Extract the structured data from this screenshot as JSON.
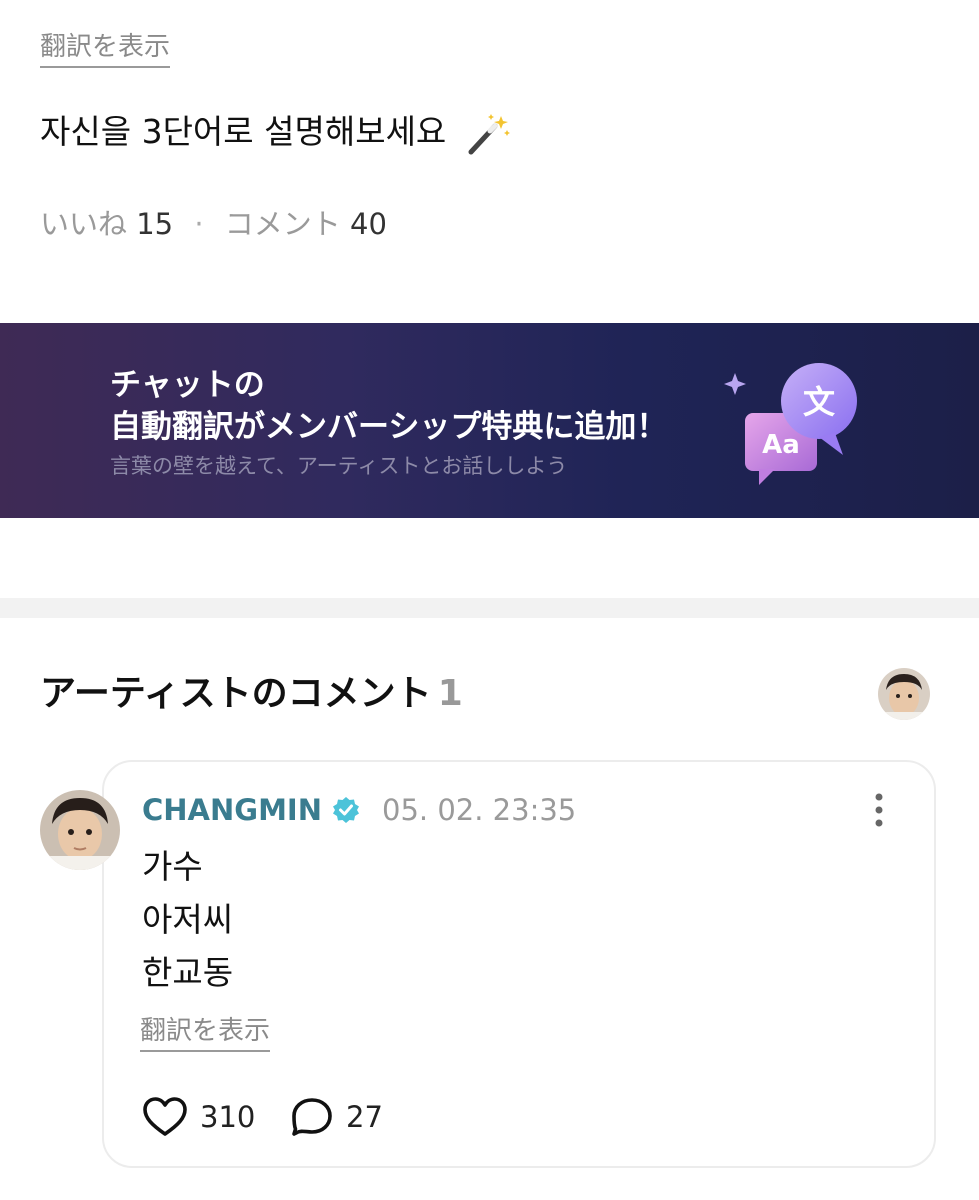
{
  "post": {
    "translate_label": "翻訳を表示",
    "text": "자신을 3단어로 설명해보세요",
    "wand_icon": "magic-wand-icon",
    "likes_label": "いいね",
    "likes_count": "15",
    "separator": "·",
    "comments_label": "コメント",
    "comments_count": "40"
  },
  "banner": {
    "line1": "チャットの",
    "line2": "自動翻訳がメンバーシップ特典に追加！",
    "line3": "言葉の壁を越えて、アーティストとお話ししよう",
    "icon_badge_1": "文",
    "icon_badge_2": "Aa"
  },
  "artist_comments": {
    "title": "アーティストのコメント",
    "count": "1"
  },
  "comment": {
    "author": "CHANGMIN",
    "date": "05. 02. 23:35",
    "lines": [
      "가수",
      "아저씨",
      "한교동"
    ],
    "translate_label": "翻訳を表示",
    "likes": "310",
    "replies": "27"
  },
  "colors": {
    "author": "#3a7c8f",
    "verified": "#4cc3d9",
    "banner_start": "#3f2a55",
    "banner_end": "#1c1f48"
  }
}
